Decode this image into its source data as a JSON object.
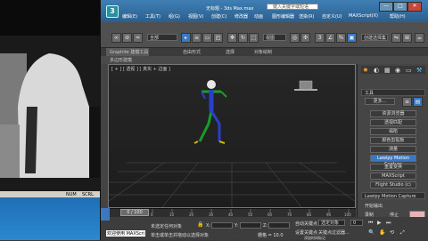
{
  "background_window": {
    "status_num": "NUM",
    "status_scrl": "SCRL"
  },
  "max": {
    "title": "无标题 - 3ds Max.max",
    "search_placeholder": "键入关键字或短语",
    "menu": [
      "编辑(E)",
      "工具(T)",
      "组(G)",
      "视图(V)",
      "创建(C)",
      "修改器",
      "动画",
      "图形编辑器",
      "渲染(R)",
      "自定义(U)",
      "MAXScript(X)",
      "帮助(H)"
    ],
    "win_controls": [
      "—",
      "□",
      "✕"
    ],
    "toolbar": {
      "selection_filter": "全部",
      "coord_system": "视图",
      "named_set": "创建选择集"
    },
    "ribbon": {
      "tabs": [
        "Graphite 建模工具",
        "自由形式",
        "选择",
        "对象绘制"
      ],
      "sub": "多边形建模"
    },
    "viewport": {
      "label": "[ + ] [ 透视 ] [ 真实 + 边面 ]"
    },
    "panel": {
      "header": "工具",
      "more_button": "更多...",
      "buttons": [
        "资源浏览器",
        "透视匹配",
        "塌陷",
        "颜色剪贴板",
        "测量",
        "Lawipy Motion Capture",
        "重置变换",
        "MAXScript",
        "Flight Studio (c)"
      ],
      "selected_index": 5,
      "rollout": "Lawipy Motion Capture",
      "rollout_start": "开始输出",
      "rollout_options": [
        "录制",
        "停止"
      ]
    },
    "timeline": {
      "slider": "0 / 100",
      "ticks": [
        "0",
        "10",
        "20",
        "30",
        "40",
        "50",
        "60",
        "70",
        "80",
        "90",
        "100"
      ]
    },
    "status": {
      "selected": "未选定任何对象",
      "prompt": "单击或单击并拖动以选择对象",
      "maxscript": "欢迎使用 MAXScri",
      "x_label": "X:",
      "y_label": "Y:",
      "z_label": "Z:",
      "grid": "栅格 = 10.0",
      "auto_key": "自动关键点",
      "set_key": "设置关键点",
      "selected_set": "选定对象",
      "key_filter": "关键点过滤器...",
      "add_time_tag": "添加时间标记",
      "frame": "0"
    }
  }
}
